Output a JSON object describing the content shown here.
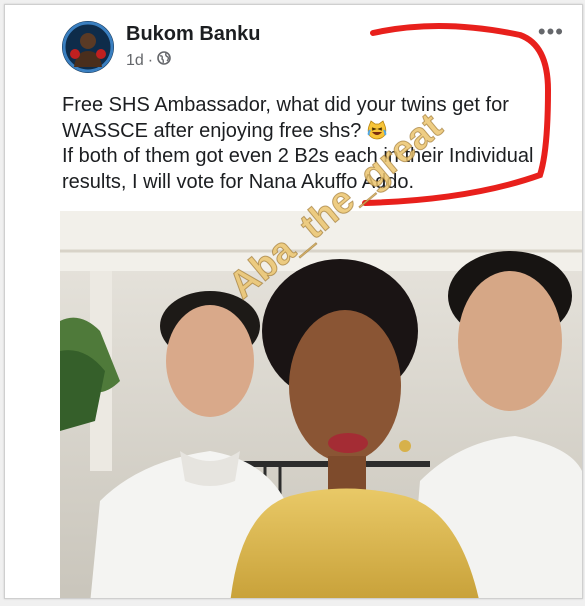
{
  "post": {
    "author": "Bukom Banku",
    "time": "1d",
    "separator": "·",
    "privacy_icon": "globe-icon",
    "more_icon": "more-options-icon",
    "lines": [
      "Free SHS Ambassador, what did your twins get for",
      "WASSCE after enjoying free shs?",
      "If both of them got even 2 B2s each in their Individual",
      "results, I will vote for Nana Akuffo Addo."
    ],
    "emoji": "laughing-crying-cat-emoji"
  },
  "photo": {
    "watermark": "Aba_the_great"
  },
  "colors": {
    "text": "#1c1e21",
    "muted": "#65676b",
    "annotation": "#e8201c"
  }
}
